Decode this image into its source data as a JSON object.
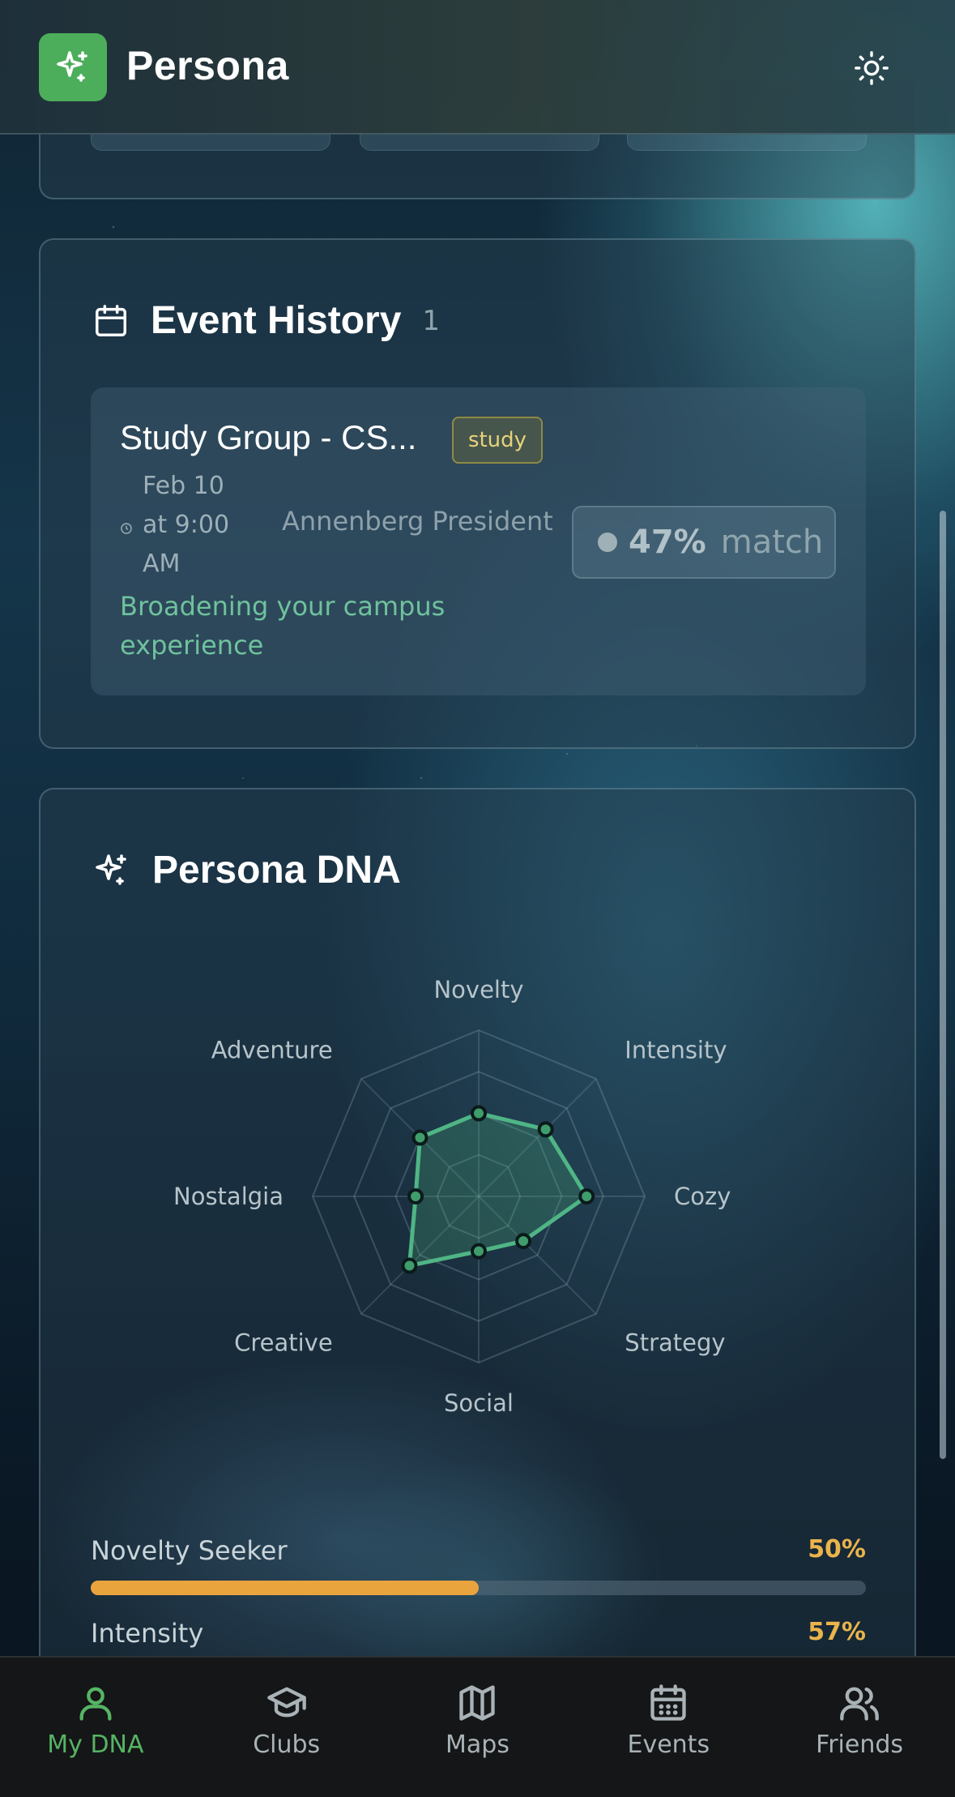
{
  "app": {
    "title": "Persona",
    "logo_icon": "sparkles-icon",
    "theme_icon": "sun-icon"
  },
  "colors": {
    "accent": "#4cae5a",
    "match_green": "#6fc29d",
    "trait_orange": "#eaa43e",
    "tag_yellow": "#e6d27a"
  },
  "event_history": {
    "title": "Event History",
    "count": "1",
    "events": [
      {
        "title": "Study Group - CS...",
        "tag": "study",
        "date_line1": "Feb 10",
        "date_line2": "at 9:00",
        "date_line3": "AM",
        "location": "Annenberg President",
        "match_pct": "47%",
        "match_word": "match",
        "reason": "Broadening your campus experience"
      }
    ]
  },
  "persona_dna": {
    "title": "Persona DNA",
    "axes": [
      "Novelty",
      "Intensity",
      "Cozy",
      "Strategy",
      "Social",
      "Creative",
      "Nostalgia",
      "Adventure"
    ],
    "traits": [
      {
        "name": "Novelty Seeker",
        "pct_label": "50%",
        "value": 0.5
      },
      {
        "name": "Intensity",
        "pct_label": "57%",
        "value": 0.57
      }
    ]
  },
  "chart_data": {
    "type": "radar",
    "axes": [
      "Novelty",
      "Intensity",
      "Cozy",
      "Strategy",
      "Social",
      "Creative",
      "Nostalgia",
      "Adventure"
    ],
    "values": [
      0.5,
      0.57,
      0.65,
      0.38,
      0.33,
      0.59,
      0.38,
      0.5
    ],
    "range": [
      0,
      1
    ],
    "rings": 4
  },
  "nav": {
    "items": [
      {
        "label": "My DNA",
        "icon": "user-icon",
        "active": true
      },
      {
        "label": "Clubs",
        "icon": "graduation-cap-icon",
        "active": false
      },
      {
        "label": "Maps",
        "icon": "map-icon",
        "active": false
      },
      {
        "label": "Events",
        "icon": "calendar-icon",
        "active": false
      },
      {
        "label": "Friends",
        "icon": "users-icon",
        "active": false
      }
    ]
  }
}
